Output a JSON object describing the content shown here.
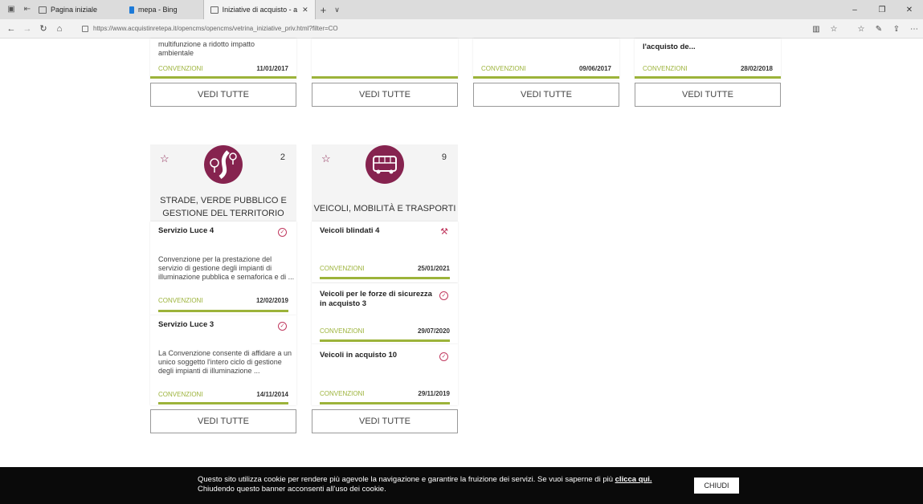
{
  "browser": {
    "tabs": [
      {
        "label": "Pagina iniziale"
      },
      {
        "label": "mepa - Bing"
      },
      {
        "label": "Iniziative di acquisto - a"
      }
    ],
    "url_host": "https://www.acquistinretepa.it",
    "url_path": "/opencms/opencms/vetrina_iniziative_priv.html?filter=CO"
  },
  "top_cards": [
    {
      "text": "multifunzione a ridotto impatto ambientale",
      "tag": "CONVENZIONI",
      "date": "11/01/2017"
    },
    {
      "text": "",
      "tag": "",
      "date": ""
    },
    {
      "text": "",
      "tag": "CONVENZIONI",
      "date": "09/06/2017"
    },
    {
      "text": "l'acquisto de...",
      "tag": "CONVENZIONI",
      "date": "28/02/2018"
    }
  ],
  "see_all_label": "VEDI TUTTE",
  "categories": [
    {
      "title_line1": "STRADE, VERDE PUBBLICO E",
      "title_line2": "GESTIONE DEL TERRITORIO",
      "count": "2",
      "items": [
        {
          "title": "Servizio Luce 4",
          "desc": "Convenzione per la prestazione del servizio di gestione degli impianti di illuminazione pubblica e semaforica e di ...",
          "tag": "CONVENZIONI",
          "date": "12/02/2019"
        },
        {
          "title": "Servizio Luce 3",
          "desc": "La Convenzione consente di affidare a un unico soggetto l'intero ciclo di gestione degli impianti di illuminazione ...",
          "tag": "CONVENZIONI",
          "date": "14/11/2014"
        }
      ]
    },
    {
      "title_line1": "VEICOLI, MOBILITÀ E TRASPORTI",
      "title_line2": "",
      "count": "9",
      "items": [
        {
          "title": "Veicoli blindati 4",
          "tag": "CONVENZIONI",
          "date": "25/01/2021"
        },
        {
          "title": "Veicoli per le forze di sicurezza in acquisto 3",
          "tag": "CONVENZIONI",
          "date": "29/07/2020"
        },
        {
          "title": "Veicoli in acquisto 10",
          "tag": "CONVENZIONI",
          "date": "29/11/2019"
        }
      ]
    }
  ],
  "cookie": {
    "line1": "Questo sito utilizza cookie per rendere più agevole la navigazione e garantire la fruizione dei servizi. Se vuoi saperne di più",
    "link": "clicca qui.",
    "line2": "Chiudendo questo banner acconsenti all'uso dei cookie.",
    "close": "CHIUDI"
  },
  "colors": {
    "accent": "#86234f",
    "green": "#9cb33a"
  }
}
